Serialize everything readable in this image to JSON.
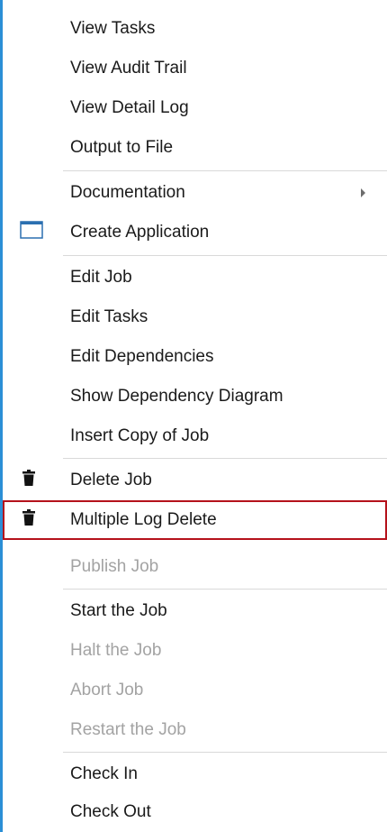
{
  "menu": {
    "items": [
      {
        "label": "View Tasks"
      },
      {
        "label": "View Audit Trail"
      },
      {
        "label": "View Detail Log"
      },
      {
        "label": "Output to File"
      },
      {
        "label": "Documentation",
        "submenu": true
      },
      {
        "label": "Create Application",
        "icon": "window-icon"
      },
      {
        "label": "Edit Job"
      },
      {
        "label": "Edit Tasks"
      },
      {
        "label": "Edit Dependencies"
      },
      {
        "label": "Show Dependency Diagram"
      },
      {
        "label": "Insert Copy of Job"
      },
      {
        "label": "Delete Job",
        "icon": "trash-icon"
      },
      {
        "label": "Multiple Log Delete",
        "icon": "trash-icon",
        "highlighted": true
      },
      {
        "label": "Publish Job",
        "disabled": true
      },
      {
        "label": "Start the Job"
      },
      {
        "label": "Halt the Job",
        "disabled": true
      },
      {
        "label": "Abort Job",
        "disabled": true
      },
      {
        "label": "Restart the Job",
        "disabled": true
      },
      {
        "label": "Check In"
      },
      {
        "label": "Check Out"
      }
    ]
  },
  "colors": {
    "left_edge": "#2b8fd6",
    "highlight_border": "#b5121b",
    "disabled_text": "#a3a3a3",
    "separator": "#d9d9d9"
  }
}
